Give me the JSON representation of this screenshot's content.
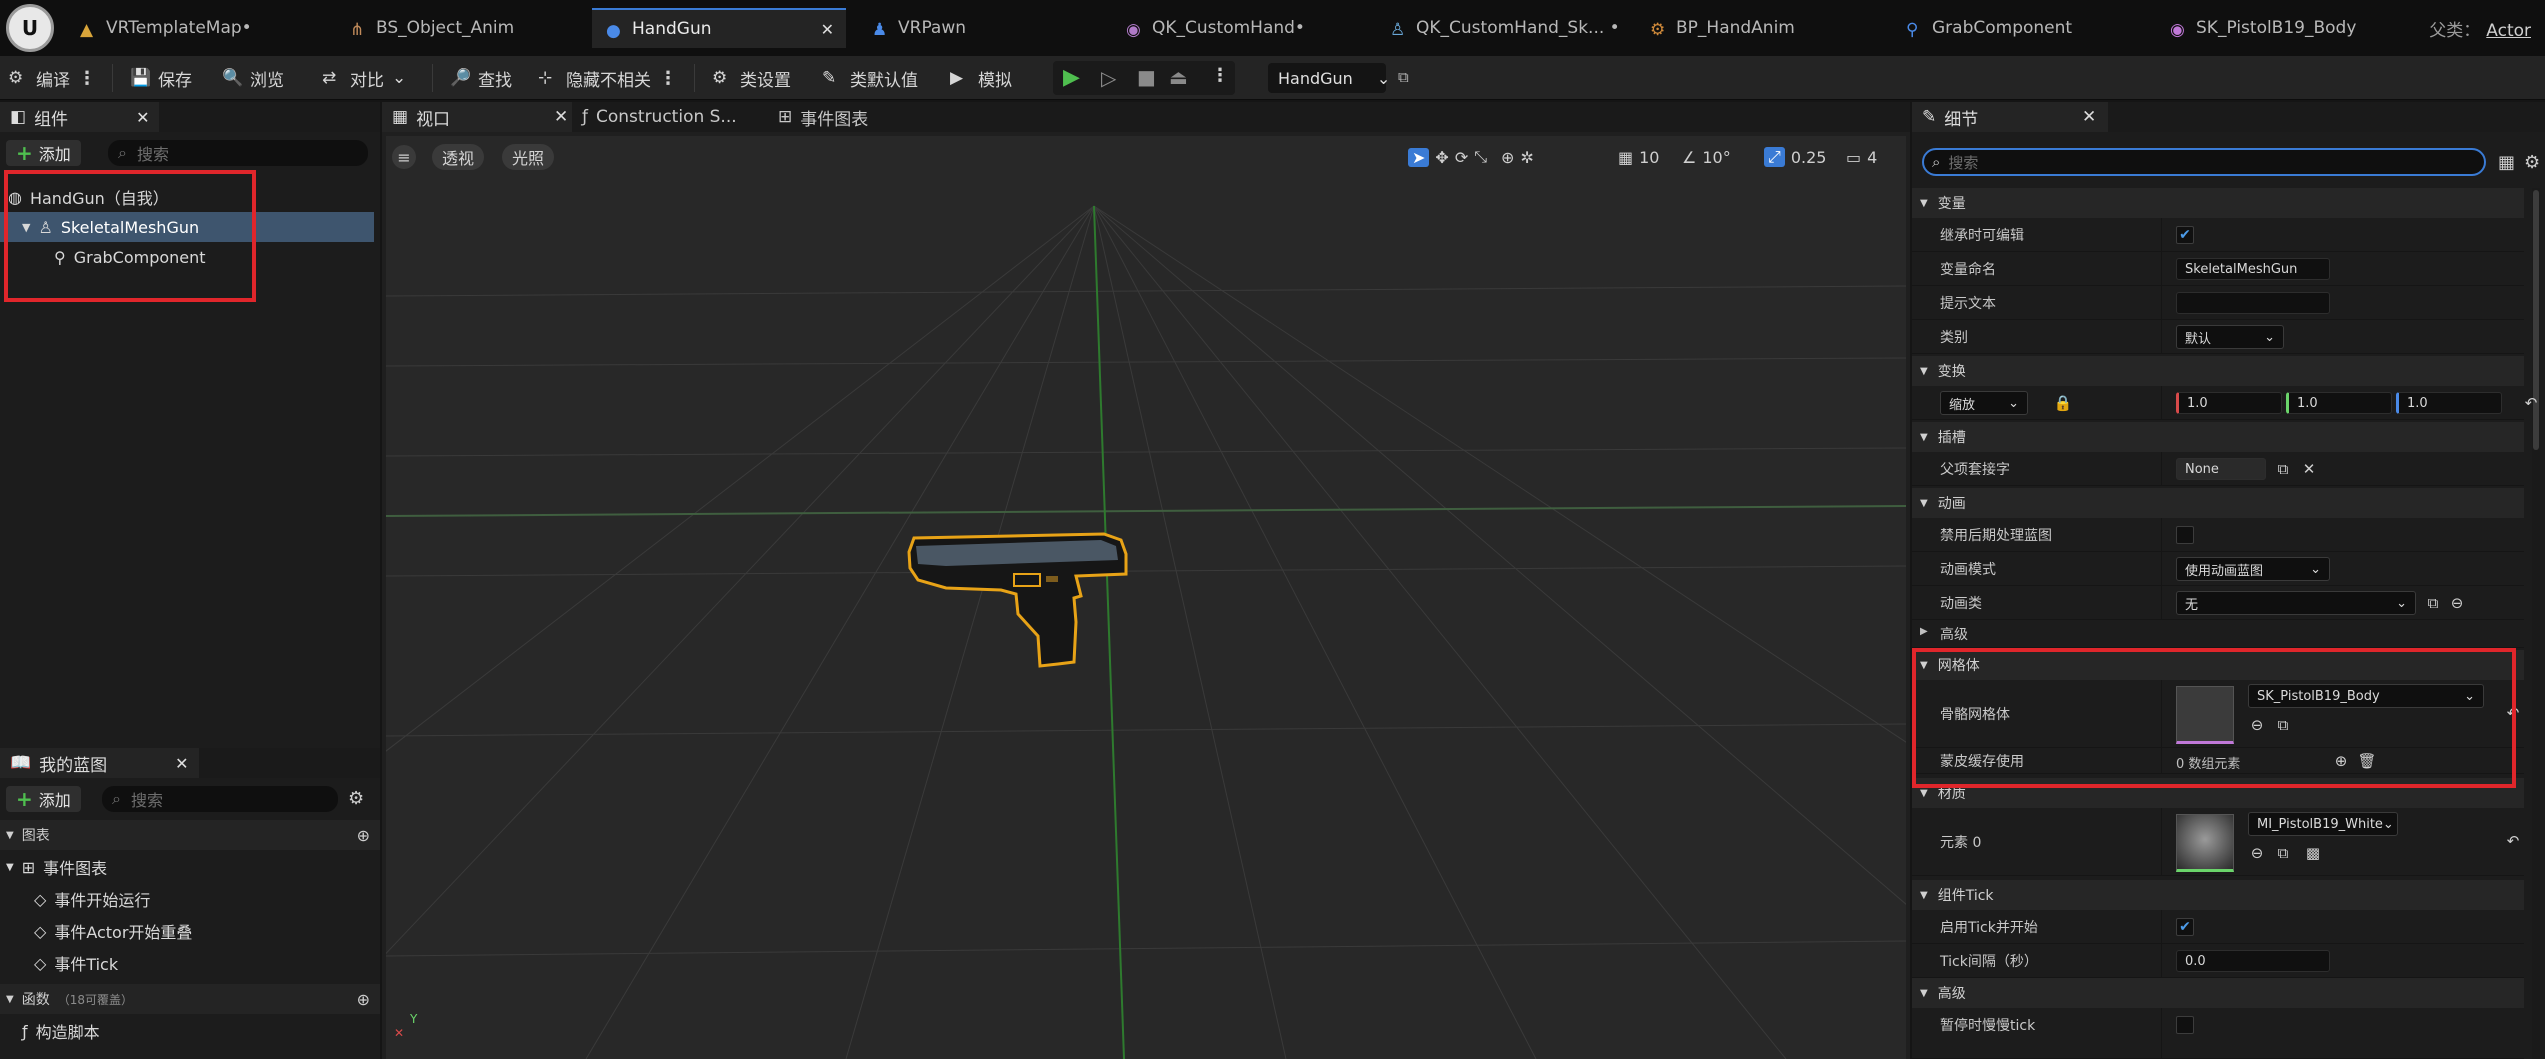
{
  "tabs": [
    {
      "label": "VRTemplateMap•",
      "icon": "level-icon"
    },
    {
      "label": "BS_Object_Anim",
      "icon": "blendspace-icon"
    },
    {
      "label": "HandGun",
      "icon": "blueprint-icon",
      "active": true
    },
    {
      "label": "VRPawn",
      "icon": "pawn-icon"
    },
    {
      "label": "QK_CustomHand•",
      "icon": "material-icon"
    },
    {
      "label": "QK_CustomHand_Sk... •",
      "icon": "skeleton-icon"
    },
    {
      "label": "BP_HandAnim",
      "icon": "animbp-icon"
    },
    {
      "label": "GrabComponent",
      "icon": "component-icon"
    },
    {
      "label": "SK_PistolB19_Body",
      "icon": "skeletal-mesh-icon"
    }
  ],
  "parent": {
    "label": "父类：",
    "value": "Actor"
  },
  "toolbar": {
    "compile": "编译",
    "save": "保存",
    "browse": "浏览",
    "diff": "对比",
    "find": "查找",
    "hide_unrelated": "隐藏不相关",
    "class_settings": "类设置",
    "class_defaults": "类默认值",
    "simulate": "模拟",
    "debug_object": "HandGun"
  },
  "components_panel": {
    "title": "组件",
    "add": "添加",
    "search_placeholder": "搜索",
    "items": [
      {
        "label": "HandGun（自我）"
      },
      {
        "label": "SkeletalMeshGun"
      },
      {
        "label": "GrabComponent"
      }
    ]
  },
  "my_blueprint": {
    "title": "我的蓝图",
    "add": "添加",
    "search_placeholder": "搜索",
    "graphs_section": "图表",
    "event_graph": "事件图表",
    "events": [
      "事件开始运行",
      "事件Actor开始重叠",
      "事件Tick"
    ],
    "functions_section": "函数",
    "functions_hint": "（18可覆盖）",
    "construction_script": "构造脚本"
  },
  "center_tabs": [
    {
      "label": "视口",
      "active": true
    },
    {
      "label": "Construction S..."
    },
    {
      "label": "事件图表"
    }
  ],
  "viewport": {
    "perspective": "透视",
    "lighting": "光照",
    "grid_snap": "10",
    "rotation_snap": "10°",
    "scale_snap": "0.25",
    "camera_speed": "4",
    "axis_y": "Y"
  },
  "details": {
    "title": "细节",
    "search_placeholder": "搜索",
    "sections": {
      "variable": "变量",
      "transform": "变换",
      "sockets": "插槽",
      "animation": "动画",
      "advanced": "高级",
      "mesh": "网格体",
      "materials": "材质",
      "component_tick": "组件Tick",
      "advanced2": "高级"
    },
    "props": {
      "editable_when_inherited": "继承时可编辑",
      "variable_name": "变量命名",
      "variable_name_value": "SkeletalMeshGun",
      "tooltip": "提示文本",
      "category": "类别",
      "category_value": "默认",
      "transform_mode": "缩放",
      "scale_x": "1.0",
      "scale_y": "1.0",
      "scale_z": "1.0",
      "parent_socket": "父项套接字",
      "parent_socket_value": "None",
      "disable_post_process": "禁用后期处理蓝图",
      "animation_mode": "动画模式",
      "animation_mode_value": "使用动画蓝图",
      "anim_class": "动画类",
      "anim_class_value": "无",
      "skeletal_mesh": "骨骼网格体",
      "skeletal_mesh_value": "SK_PistolB19_Body",
      "skin_cache": "蒙皮缓存使用",
      "skin_cache_value": "0 数组元素",
      "element0": "元素 0",
      "element0_value": "MI_PistolB19_White",
      "start_tick": "启用Tick并开始",
      "tick_interval": "Tick间隔（秒）",
      "tick_interval_value": "0.0",
      "tick_even_paused": "暂停时慢慢tick"
    }
  },
  "colors": {
    "accent_blue": "#3a7bd5",
    "highlight_red": "#e0262b",
    "selection": "#3e556e",
    "outline_orange": "#e8a317",
    "play_green": "#4fbf4f"
  }
}
